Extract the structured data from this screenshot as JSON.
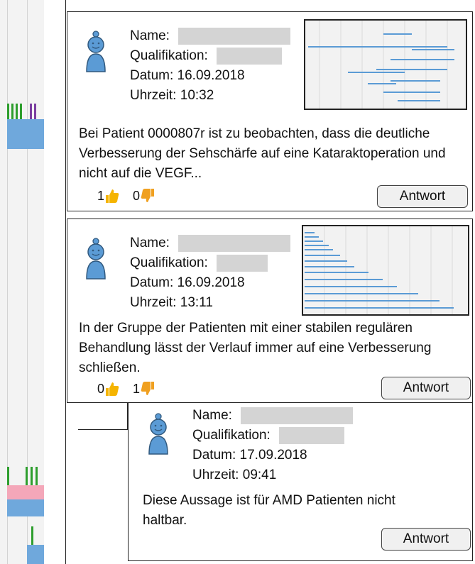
{
  "labels": {
    "name": "Name:",
    "qualification": "Qualifikation:",
    "date_prefix": "Datum:",
    "time_prefix": "Uhrzeit:"
  },
  "comments": [
    {
      "date": "16.09.2018",
      "time": "10:32",
      "text": "Bei Patient 0000807r ist zu beobachten, dass die deutliche Verbesserung der Sehschärfe auf eine Kataraktoperation und nicht auf die VEGF...",
      "likes": "1",
      "dislikes": "0",
      "answer_label": "Antwort"
    },
    {
      "date": "16.09.2018",
      "time": "13:11",
      "text": "In der Gruppe der Patienten mit einer stabilen regulären Behandlung lässt der Verlauf immer auf eine Verbesserung schließen.",
      "likes": "0",
      "dislikes": "1",
      "answer_label": "Antwort"
    },
    {
      "date": "17.09.2018",
      "time": "09:41",
      "text": "Diese Aussage ist für AMD Patienten nicht haltbar.",
      "answer_label": "Antwort"
    }
  ],
  "colors": {
    "avatar": "#5b9bd5",
    "thumbs_up": "#f5b400",
    "thumbs_down": "#f0a020",
    "strip_blue": "#6fa8dc",
    "strip_green": "#2e9e2e",
    "strip_purple": "#7b3fa0",
    "strip_pink": "#f4a7b9"
  }
}
